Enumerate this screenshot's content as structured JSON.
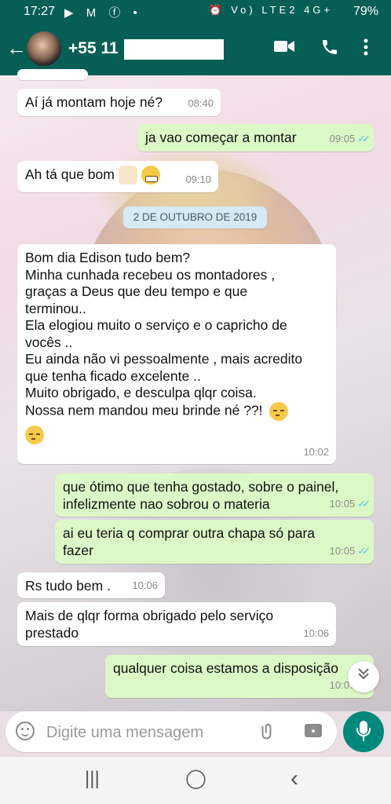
{
  "status_bar": {
    "time": "17:27",
    "left_icons": "▶ M ⓕ •",
    "right_icons": "⏰ Vo) LTE2 4G+",
    "battery": "79%"
  },
  "header": {
    "back_icon": "arrow-back",
    "contact_name": "+55 11",
    "video_icon": "video-call",
    "call_icon": "phone",
    "menu_icon": "more-vertical"
  },
  "messages": [
    {
      "direction": "in",
      "text": "Aí já montam hoje né?",
      "time": "08:40"
    },
    {
      "direction": "out",
      "text": "ja vao começar a montar",
      "time": "09:05"
    },
    {
      "direction": "in",
      "text": "Ah tá que bom",
      "time": "09:10"
    },
    {
      "direction": "in",
      "text": "Bom dia Edison tudo bem?\nMinha cunhada recebeu os montadores ,\ngraças a Deus que deu tempo e que\nterminou..\nEla elogiou muito o serviço e o capricho de\nvocês ..\nEu ainda não vi pessoalmente , mais acredito\nque tenha ficado excelente ..\nMuito obrigado, e desculpa qlqr coisa.\nNossa nem mandou meu brinde né ??!",
      "time": "10:02"
    },
    {
      "direction": "out",
      "text": "que ótimo que tenha gostado, sobre o painel,\ninfelizmente nao sobrou o materia",
      "time": "10:05"
    },
    {
      "direction": "out",
      "text": "ai eu teria q comprar outra chapa só para\nfazer",
      "time": "10:05"
    },
    {
      "direction": "in",
      "text": "Rs tudo bem .",
      "time": "10:06"
    },
    {
      "direction": "in",
      "text": "Mais de qlqr forma obrigado pelo serviço\nprestado",
      "time": "10:06"
    },
    {
      "direction": "out",
      "text": "qualquer coisa estamos a disposição",
      "time": "10:07"
    }
  ],
  "date_divider": "2 DE OUTUBRO DE 2019",
  "composer": {
    "placeholder": "Digite uma mensagem",
    "emoji_icon": "emoji",
    "attach_icon": "paperclip",
    "camera_icon": "camera",
    "mic_icon": "microphone"
  },
  "scroll_down_icon": "double-chevron-down",
  "nav": {
    "recents_icon": "|||",
    "home_icon": "◯",
    "back_icon": "‹"
  },
  "colors": {
    "header": "#075e54",
    "outgoing_bubble": "#dcf8c6",
    "incoming_bubble": "#ffffff",
    "read_ticks": "#4fc3f7",
    "mic_button": "#00897b"
  }
}
